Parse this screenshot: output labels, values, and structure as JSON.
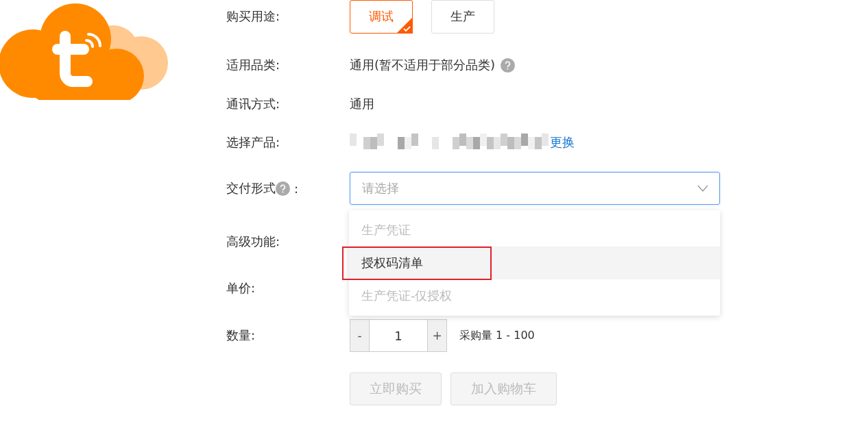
{
  "purpose": {
    "label": "购买用途:",
    "options": [
      {
        "label": "调试",
        "selected": true
      },
      {
        "label": "生产",
        "selected": false
      }
    ]
  },
  "category": {
    "label": "适用品类:",
    "value": "通用(暂不适用于部分品类)",
    "help": true
  },
  "communication": {
    "label": "通讯方式:",
    "value": "通用"
  },
  "product": {
    "label": "选择产品:",
    "change_link": "更换"
  },
  "delivery": {
    "label": "交付形式",
    "help": true,
    "colon": ":",
    "placeholder": "请选择",
    "expanded": true,
    "options": [
      {
        "label": "生产凭证",
        "disabled": true,
        "hovered": false,
        "annotated": false
      },
      {
        "label": "授权码清单",
        "disabled": false,
        "hovered": true,
        "annotated": true
      },
      {
        "label": "生产凭证-仅授权",
        "disabled": true,
        "hovered": false,
        "annotated": false
      }
    ]
  },
  "advanced": {
    "label": "高级功能:"
  },
  "price": {
    "label": "单价:"
  },
  "quantity": {
    "label": "数量:",
    "minus": "-",
    "value": "1",
    "plus": "+",
    "range": "采购量 1 - 100"
  },
  "buttons": [
    {
      "label": "立即购买",
      "disabled": true
    },
    {
      "label": "加入购物车",
      "disabled": true
    }
  ]
}
